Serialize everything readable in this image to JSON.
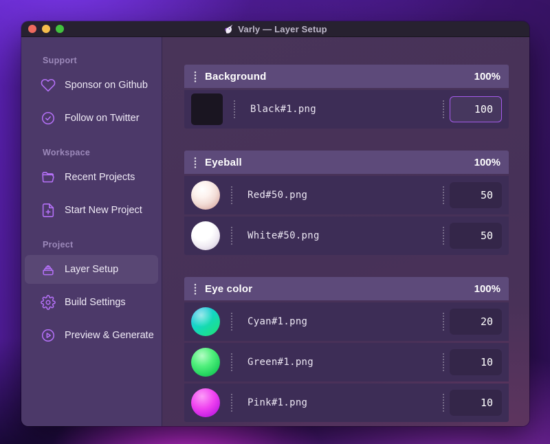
{
  "window": {
    "title": "Varly — Layer Setup"
  },
  "sidebar": {
    "sections": [
      {
        "label": "Support",
        "items": [
          {
            "label": "Sponsor on Github",
            "icon": "heart-icon"
          },
          {
            "label": "Follow on Twitter",
            "icon": "badge-check-icon"
          }
        ]
      },
      {
        "label": "Workspace",
        "items": [
          {
            "label": "Recent Projects",
            "icon": "folder-icon"
          },
          {
            "label": "Start New Project",
            "icon": "file-plus-icon"
          }
        ]
      },
      {
        "label": "Project",
        "items": [
          {
            "label": "Layer Setup",
            "icon": "layers-icon",
            "selected": true
          },
          {
            "label": "Build Settings",
            "icon": "gear-icon"
          },
          {
            "label": "Preview & Generate",
            "icon": "play-circle-icon"
          }
        ]
      }
    ]
  },
  "groups": [
    {
      "name": "Background",
      "percent": "100%",
      "rows": [
        {
          "filename": "Black#1.png",
          "value": "100",
          "thumb": "black",
          "focused": true
        }
      ]
    },
    {
      "name": "Eyeball",
      "percent": "100%",
      "rows": [
        {
          "filename": "Red#50.png",
          "value": "50",
          "thumb": "red"
        },
        {
          "filename": "White#50.png",
          "value": "50",
          "thumb": "white"
        }
      ]
    },
    {
      "name": "Eye color",
      "percent": "100%",
      "rows": [
        {
          "filename": "Cyan#1.png",
          "value": "20",
          "thumb": "cyan"
        },
        {
          "filename": "Green#1.png",
          "value": "10",
          "thumb": "green"
        },
        {
          "filename": "Pink#1.png",
          "value": "10",
          "thumb": "pink"
        }
      ]
    }
  ],
  "colors": {
    "accent_purple": "#b470f7",
    "focused_input_border": "#a65bee",
    "sidebar_bg": "#4c3969",
    "group_header_bg": "#5d4a7a",
    "row_bg": "#3d2d56",
    "titlebar_bg": "#272130"
  }
}
